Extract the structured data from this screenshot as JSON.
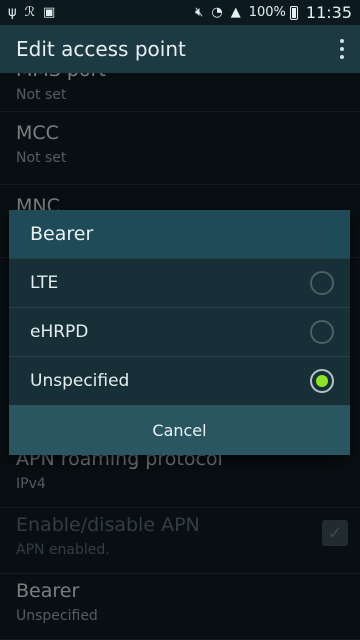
{
  "status_bar": {
    "left_icons": [
      "usb-icon",
      "r-icon",
      "image-icon"
    ],
    "right_icons": [
      "mute-icon",
      "wifi-icon",
      "signal-icon"
    ],
    "battery": "100%",
    "time": "11:35"
  },
  "app_bar": {
    "title": "Edit access point",
    "overflow_icon": "more-vert-icon"
  },
  "settings": [
    {
      "title": "MMS port",
      "subtitle": "Not set"
    },
    {
      "title": "MCC",
      "subtitle": "Not set"
    },
    {
      "title": "MNC",
      "subtitle": ""
    },
    {
      "title": "APN roaming protocol",
      "subtitle": "IPv4"
    },
    {
      "title": "Enable/disable APN",
      "subtitle": "APN enabled.",
      "checked": true,
      "disabled": true
    },
    {
      "title": "Bearer",
      "subtitle": "Unspecified"
    }
  ],
  "dialog": {
    "title": "Bearer",
    "options": [
      {
        "label": "LTE",
        "selected": false
      },
      {
        "label": "eHRPD",
        "selected": false
      },
      {
        "label": "Unspecified",
        "selected": true
      }
    ],
    "cancel_label": "Cancel",
    "accent_color": "#8ee22a"
  }
}
